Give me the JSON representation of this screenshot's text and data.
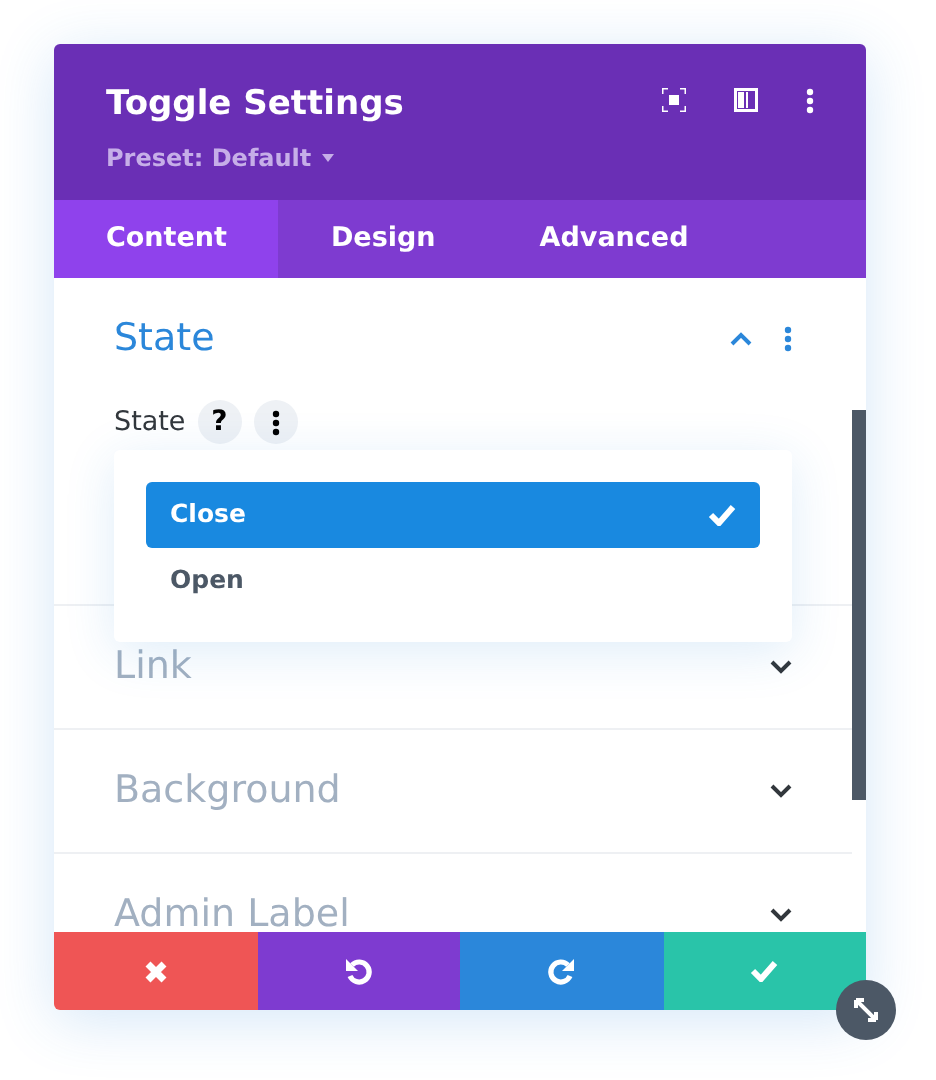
{
  "panel": {
    "title": "Toggle Settings",
    "preset": "Preset: Default"
  },
  "tabs": [
    {
      "label": "Content",
      "selected": true
    },
    {
      "label": "Design",
      "selected": false
    },
    {
      "label": "Advanced",
      "selected": false
    }
  ],
  "sections": [
    {
      "title": "State",
      "expanded": true,
      "field": {
        "label": "State",
        "help": "?",
        "dropdown": {
          "open": true,
          "options": [
            {
              "label": "Close",
              "selected": true
            },
            {
              "label": "Open",
              "selected": false
            }
          ]
        }
      }
    },
    {
      "title": "Link",
      "expanded": false
    },
    {
      "title": "Background",
      "expanded": false
    },
    {
      "title": "Admin Label",
      "expanded": false
    }
  ],
  "footer": [
    {
      "kind": "cancel"
    },
    {
      "kind": "undo"
    },
    {
      "kind": "redo"
    },
    {
      "kind": "save"
    }
  ]
}
